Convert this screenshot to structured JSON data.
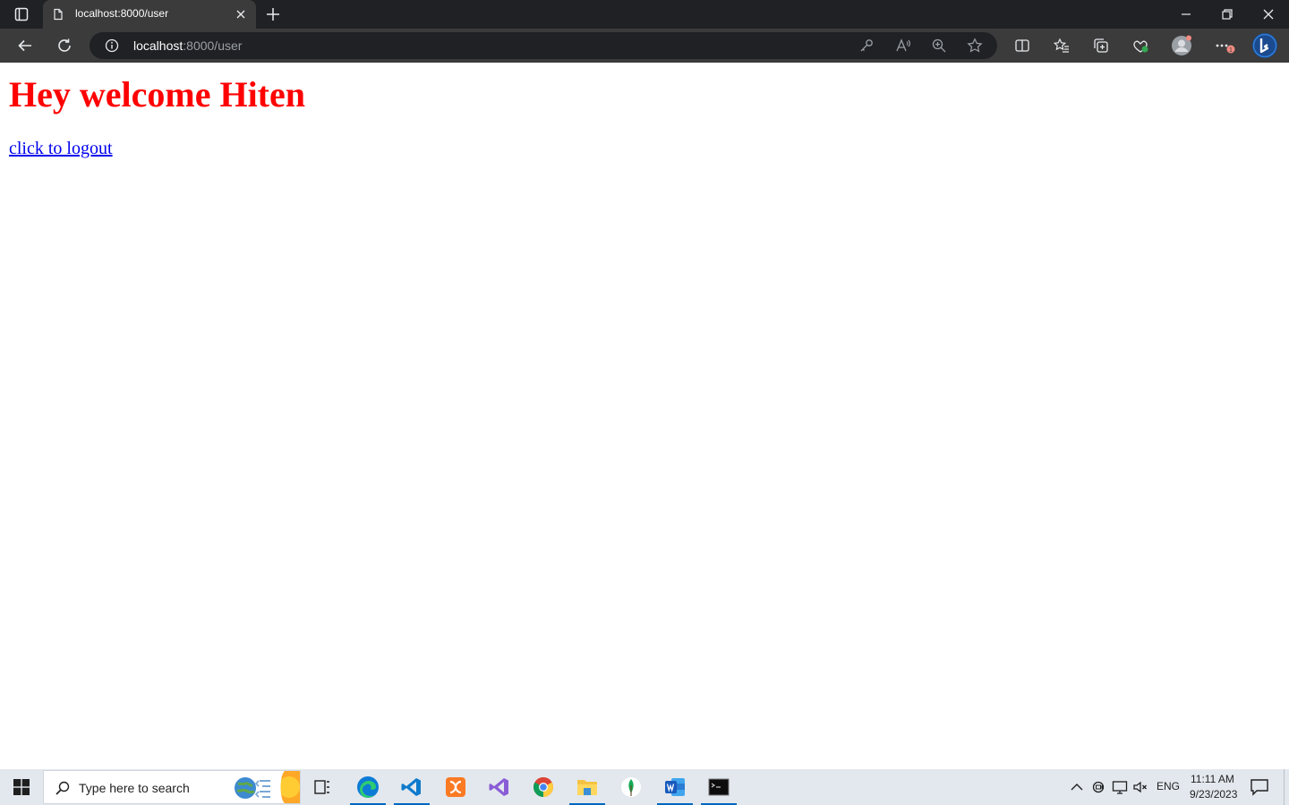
{
  "browser": {
    "tab": {
      "title": "localhost:8000/user"
    },
    "address": {
      "url_host": "localhost",
      "url_rest": ":8000/user"
    }
  },
  "page": {
    "heading": "Hey welcome Hiten",
    "logout_link": "click to logout"
  },
  "taskbar": {
    "search_placeholder": "Type here to search",
    "apps": [
      "edge",
      "vscode",
      "xampp",
      "visual-studio",
      "chrome",
      "file-explorer",
      "mongodb-compass",
      "word",
      "terminal"
    ],
    "tray": {
      "language": "ENG",
      "time": "11:11 AM",
      "date": "9/23/2023"
    }
  },
  "colors": {
    "heading": "#ff0000",
    "link": "#0000ee",
    "browser_chrome": "#3b3b3b",
    "taskbar": "#e3e8ee"
  }
}
